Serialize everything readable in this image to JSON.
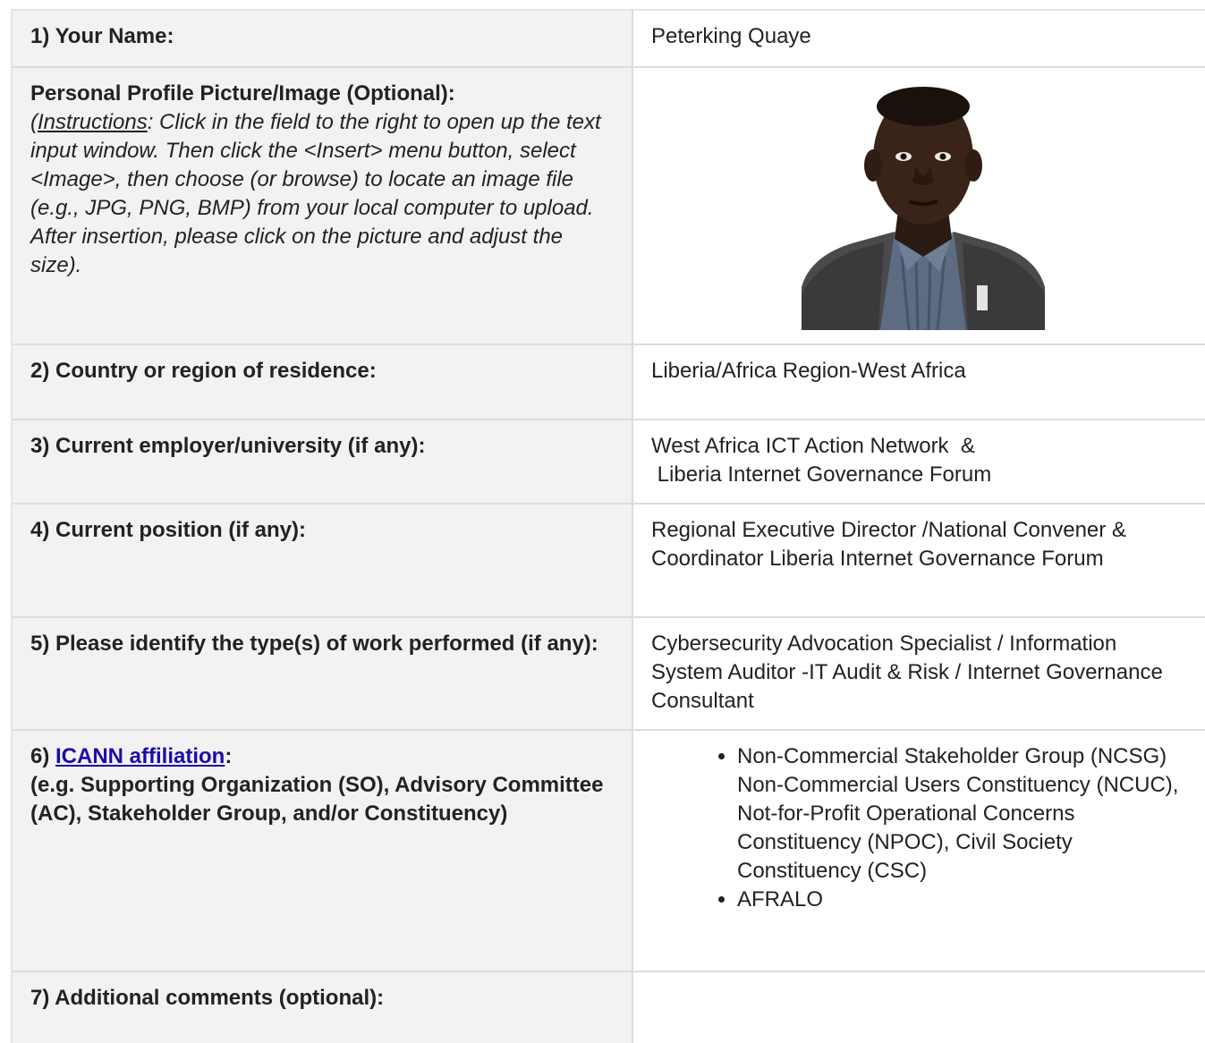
{
  "rows": {
    "name": {
      "label": "1) Your Name:",
      "value": "Peterking Quaye"
    },
    "picture": {
      "label": "Personal Profile Picture/Image (Optional):",
      "instr_open": "(",
      "instr_word": "Instructions",
      "instr_rest": ": Click in the field to the right to open up the text input window. Then click the <Insert> menu button, select <Image>, then choose (or browse) to locate an image file (e.g., JPG, PNG, BMP) from your local computer to upload. After insertion, please click on the picture and adjust the size)."
    },
    "country": {
      "label": "2) Country or region of residence:",
      "value": "Liberia/Africa Region-West Africa"
    },
    "employer": {
      "label": "3) Current employer/university (if any):",
      "value_line1": "West Africa ICT Action Network  &",
      "value_line2": " Liberia Internet Governance Forum"
    },
    "position": {
      "label": "4) Current position (if any):",
      "value": "Regional Executive Director /National Convener & Coordinator Liberia Internet Governance Forum"
    },
    "work": {
      "label": "5) Please identify the type(s) of work performed (if any):",
      "value": "Cybersecurity Advocation Specialist / Information System Auditor -IT Audit & Risk / Internet Governance Consultant"
    },
    "affiliation": {
      "label_prefix": "6) ",
      "label_link": "ICANN affiliation",
      "label_colon": ":",
      "label_rest": "(e.g. Supporting Organization (SO), Advisory Committee (AC), Stakeholder Group, and/or Constituency)",
      "items": [
        "Non-Commercial Stakeholder Group (NCSG)            Non-Commercial Users Constituency (NCUC), Not-for-Profit Operational Concerns Constituency (NPOC), Civil Society Constituency (CSC)",
        "AFRALO"
      ]
    },
    "comments": {
      "label": "7) Additional comments (optional):",
      "value": ""
    }
  },
  "colors": {
    "label_bg": "#f2f2f2",
    "border": "#dcdcdc",
    "link": "#1a0dab",
    "text": "#222222"
  },
  "icons": {
    "bullet": "disc-bullet-icon"
  }
}
